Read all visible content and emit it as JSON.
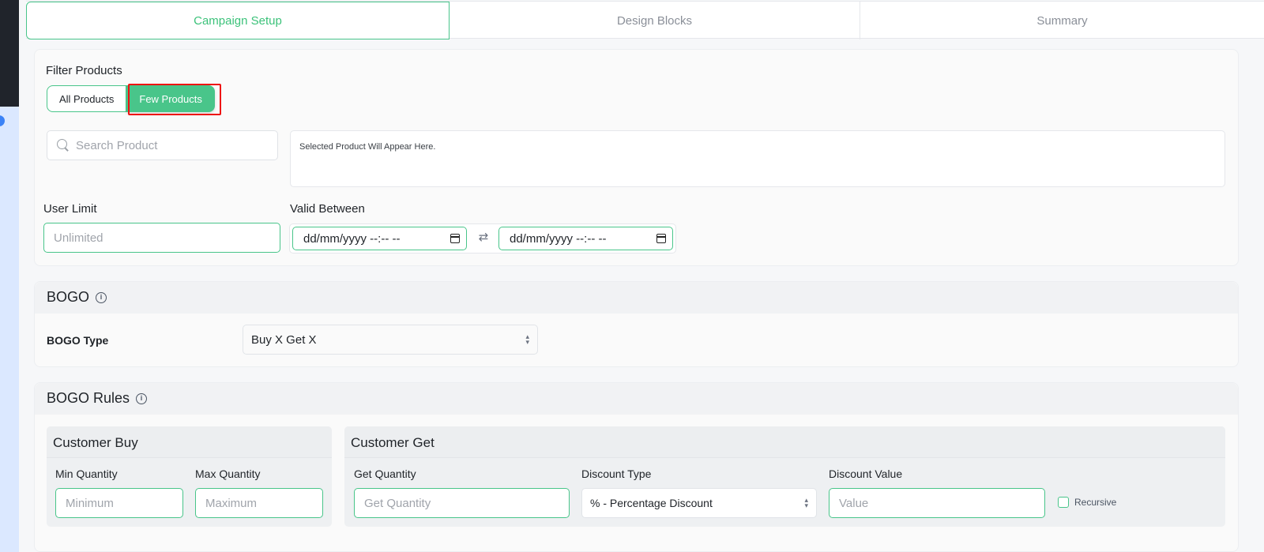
{
  "tabs": [
    {
      "label": "Campaign Setup",
      "active": true
    },
    {
      "label": "Design Blocks",
      "active": false
    },
    {
      "label": "Summary",
      "active": false
    }
  ],
  "filter": {
    "label": "Filter Products",
    "options": [
      "All Products",
      "Few Products"
    ],
    "selected": "Few Products"
  },
  "search": {
    "placeholder": "Search Product"
  },
  "selected_products": {
    "text": "Selected Product Will Appear Here."
  },
  "user_limit": {
    "label": "User Limit",
    "placeholder": "Unlimited"
  },
  "valid_between": {
    "label": "Valid Between",
    "start_value": "dd/mm/yyyy --:-- --",
    "end_value": "dd/mm/yyyy --:-- --"
  },
  "bogo": {
    "title": "BOGO",
    "type_label": "BOGO Type",
    "type_value": "Buy X Get X"
  },
  "bogo_rules": {
    "title": "BOGO Rules",
    "customer_buy": {
      "title": "Customer Buy",
      "min_label": "Min Quantity",
      "min_placeholder": "Minimum",
      "max_label": "Max Quantity",
      "max_placeholder": "Maximum"
    },
    "customer_get": {
      "title": "Customer Get",
      "get_label": "Get Quantity",
      "get_placeholder": "Get Quantity",
      "discount_type_label": "Discount Type",
      "discount_type_value": "% - Percentage Discount",
      "discount_value_label": "Discount Value",
      "discount_value_placeholder": "Value",
      "recursive_label": "Recursive"
    }
  },
  "colors": {
    "accent": "#49c58a",
    "highlight": "#ee1111"
  }
}
